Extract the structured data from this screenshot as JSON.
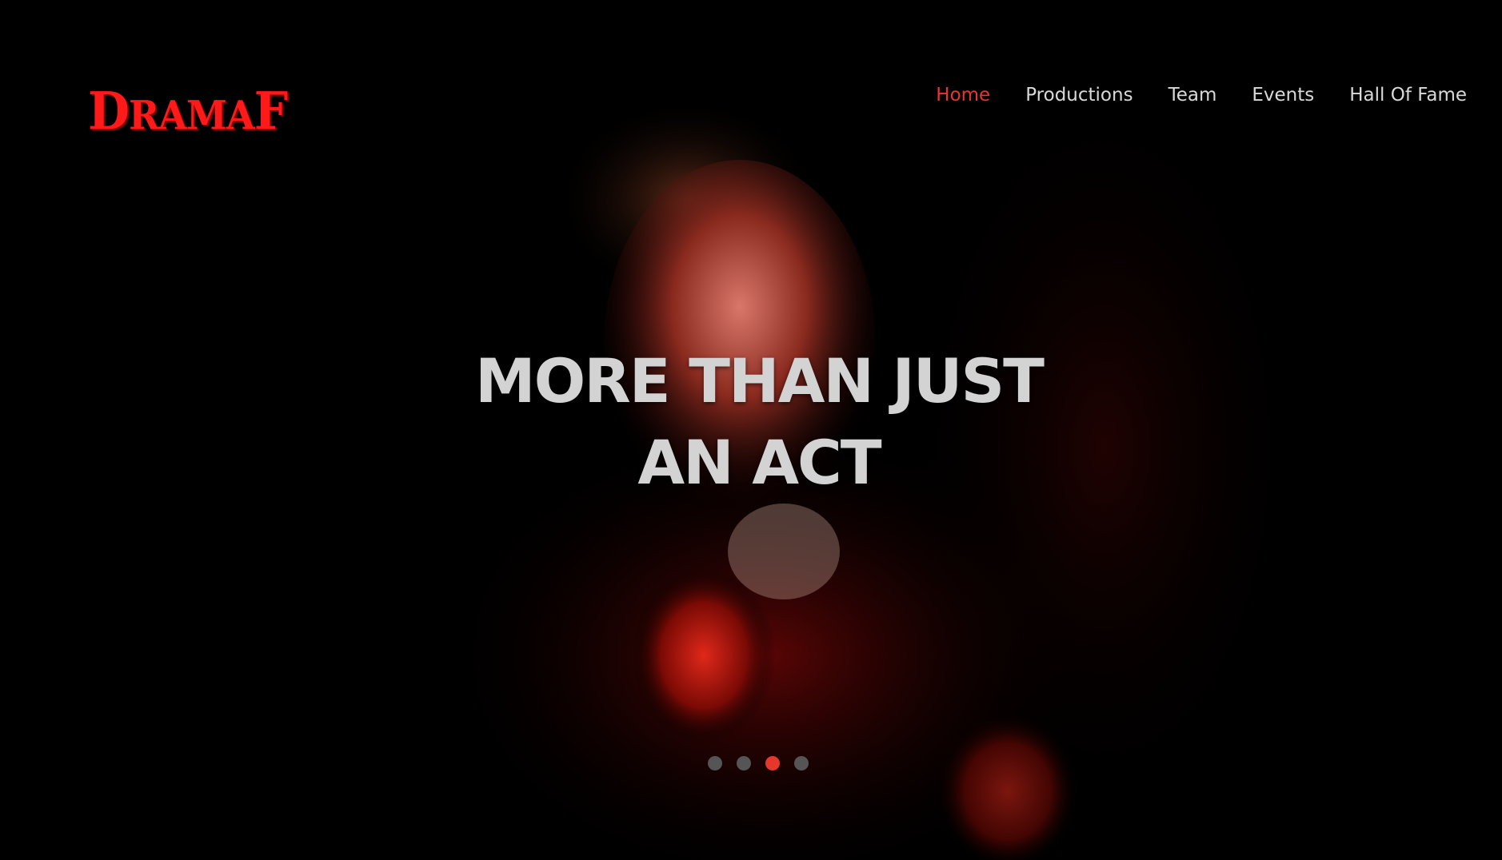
{
  "brand": {
    "logo_text_lead": "D",
    "logo_text_mid": "RAMA",
    "logo_text_tail": "F",
    "accent_color": "#e5372c"
  },
  "nav": {
    "items": [
      {
        "label": "Home",
        "active": true
      },
      {
        "label": "Productions",
        "active": false
      },
      {
        "label": "Team",
        "active": false
      },
      {
        "label": "Events",
        "active": false
      },
      {
        "label": "Hall Of Fame",
        "active": false
      }
    ]
  },
  "hero": {
    "headline_line1": "MORE THAN JUST",
    "headline_line2": "AN ACT",
    "image": "performer-red-spotlight",
    "slides": {
      "count": 4,
      "active_index": 2
    }
  }
}
